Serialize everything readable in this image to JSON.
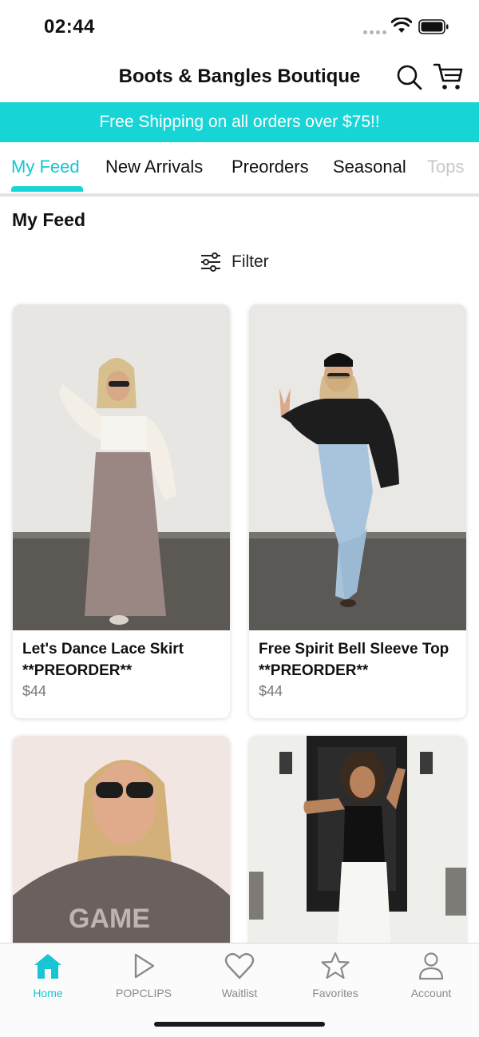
{
  "status_bar": {
    "time": "02:44"
  },
  "header": {
    "title": "Boots & Bangles Boutique"
  },
  "promo": {
    "text": "Free Shipping on all orders over $75!!"
  },
  "tabs": [
    {
      "label": "My Feed",
      "active": true
    },
    {
      "label": "New Arrivals"
    },
    {
      "label": "Preorders"
    },
    {
      "label": "Seasonal"
    },
    {
      "label": "Tops"
    }
  ],
  "feed": {
    "heading": "My Feed",
    "filter_label": "Filter"
  },
  "products": [
    {
      "name": "Let's Dance Lace Skirt **PREORDER**",
      "price": "$44"
    },
    {
      "name": "Free Spirit Bell Sleeve Top **PREORDER**",
      "price": "$44"
    }
  ],
  "tab_bar": [
    {
      "label": "Home",
      "icon": "home-icon",
      "active": true
    },
    {
      "label": "POPCLIPS",
      "icon": "play-icon"
    },
    {
      "label": "Waitlist",
      "icon": "heart-icon"
    },
    {
      "label": "Favorites",
      "icon": "star-icon"
    },
    {
      "label": "Account",
      "icon": "person-icon"
    }
  ],
  "colors": {
    "accent": "#17d4d6",
    "active_text": "#17c6d2",
    "inactive_text": "#8a8a8a"
  }
}
